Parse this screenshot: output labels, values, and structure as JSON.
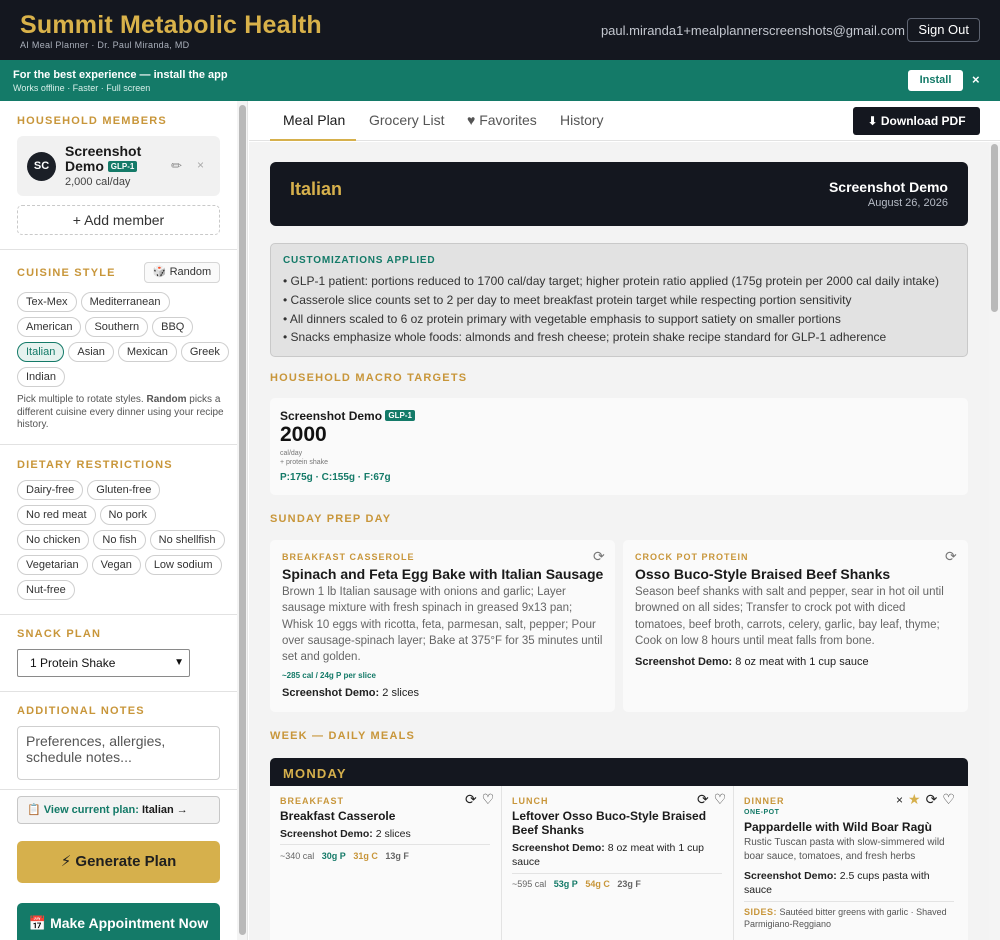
{
  "header": {
    "brand_title": "Summit Metabolic Health",
    "brand_sub": "AI Meal Planner · Dr. Paul Miranda, MD",
    "user_email": "paul.miranda1+mealplannerscreenshots@gmail.com",
    "sign_out": "Sign Out"
  },
  "install_banner": {
    "title": "For the best experience — install the app",
    "subtitle": "Works offline · Faster · Full screen",
    "install_label": "Install",
    "close_glyph": "×"
  },
  "sidebar": {
    "household_heading": "HOUSEHOLD MEMBERS",
    "member": {
      "initials": "SC",
      "name": "Screenshot Demo",
      "badge": "GLP-1",
      "calories": "2,000 cal/day",
      "edit_glyph": "✏",
      "remove_glyph": "×"
    },
    "add_member": "+ Add member",
    "cuisine_heading": "CUISINE STYLE",
    "random_label": "🎲 Random",
    "cuisines": [
      "Tex-Mex",
      "Mediterranean",
      "American",
      "Southern",
      "BBQ",
      "Italian",
      "Asian",
      "Mexican",
      "Greek",
      "Indian"
    ],
    "cuisine_selected": "Italian",
    "cuisine_note_a": "Pick multiple to rotate styles. ",
    "cuisine_note_b": "Random",
    "cuisine_note_c": " picks a different cuisine every dinner using your recipe history.",
    "dietary_heading": "DIETARY RESTRICTIONS",
    "dietary": [
      "Dairy-free",
      "Gluten-free",
      "No red meat",
      "No pork",
      "No chicken",
      "No fish",
      "No shellfish",
      "Vegetarian",
      "Vegan",
      "Low sodium",
      "Nut-free"
    ],
    "snack_heading": "SNACK PLAN",
    "snack_value": "1 Protein Shake",
    "notes_heading": "ADDITIONAL NOTES",
    "notes_placeholder": "Preferences, allergies, schedule notes...",
    "view_plan_prefix": "📋 View current plan: ",
    "view_plan_value": "Italian →",
    "generate_label": "⚡ Generate Plan",
    "appointment_label": "📅 Make Appointment Now"
  },
  "tabs": {
    "items": [
      "Meal Plan",
      "Grocery List",
      "♥ Favorites",
      "History"
    ],
    "active": "Meal Plan",
    "download_label": "⬇ Download PDF"
  },
  "plan": {
    "cuisine": "Italian",
    "owner": "Screenshot Demo",
    "date": "August 26, 2026"
  },
  "customizations": {
    "heading": "CUSTOMIZATIONS APPLIED",
    "items": [
      "• GLP-1 patient: portions reduced to 1700 cal/day target; higher protein ratio applied (175g protein per 2000 cal daily intake)",
      "• Casserole slice counts set to 2 per day to meet breakfast protein target while respecting portion sensitivity",
      "• All dinners scaled to 6 oz protein primary with vegetable emphasis to support satiety on smaller portions",
      "• Snacks emphasize whole foods: almonds and fresh cheese; protein shake recipe standard for GLP-1 adherence"
    ]
  },
  "macros": {
    "heading": "HOUSEHOLD MACRO TARGETS",
    "name": "Screenshot Demo",
    "badge": "GLP-1",
    "kcal": "2000",
    "cal_unit": "cal/day",
    "shake_note": "+ protein shake",
    "split": "P:175g · C:155g · F:67g"
  },
  "prep": {
    "heading": "SUNDAY PREP DAY",
    "cards": [
      {
        "tag": "BREAKFAST CASSEROLE",
        "title": "Spinach and Feta Egg Bake with Italian Sausage",
        "desc": "Brown 1 lb Italian sausage with onions and garlic; Layer sausage mixture with fresh spinach in greased 9x13 pan; Whisk 10 eggs with ricotta, feta, parmesan, salt, pepper; Pour over sausage-spinach layer; Bake at 375°F for 35 minutes until set and golden.",
        "nutrition": "~285 cal / 24g P per slice",
        "serving_name": "Screenshot Demo:",
        "serving": "2 slices"
      },
      {
        "tag": "CROCK POT PROTEIN",
        "title": "Osso Buco-Style Braised Beef Shanks",
        "desc": "Season beef shanks with salt and pepper, sear in hot oil until browned on all sides; Transfer to crock pot with diced tomatoes, beef broth, carrots, celery, garlic, bay leaf, thyme; Cook on low 8 hours until meat falls from bone.",
        "serving_name": "Screenshot Demo:",
        "serving": "8 oz meat with 1 cup sauce"
      }
    ]
  },
  "week": {
    "heading": "WEEK — DAILY MEALS",
    "day": "MONDAY",
    "meals": [
      {
        "type": "BREAKFAST",
        "name": "Breakfast Casserole",
        "serving_name": "Screenshot Demo:",
        "serving": "2 slices",
        "cal": "~340 cal",
        "p": "30g P",
        "c": "31g C",
        "f": "13g F"
      },
      {
        "type": "LUNCH",
        "name": "Leftover Osso Buco-Style Braised Beef Shanks",
        "serving_name": "Screenshot Demo:",
        "serving": "8 oz meat with 1 cup sauce",
        "cal": "~595 cal",
        "p": "53g P",
        "c": "54g C",
        "f": "23g F"
      },
      {
        "type": "DINNER",
        "subtype": "ONE-POT",
        "name": "Pappardelle with Wild Boar Ragù",
        "desc": "Rustic Tuscan pasta with slow-simmered wild boar sauce, tomatoes, and fresh herbs",
        "serving_name": "Screenshot Demo:",
        "serving": "2.5 cups pasta with sauce",
        "sides_label": "SIDES:",
        "sides": "Sautéed bitter greens with garlic · Shaved Parmigiano-Reggiano"
      }
    ]
  },
  "colors": {
    "gold": "#d6b04c",
    "teal": "#147a68",
    "dark": "#14171f"
  },
  "icons": {
    "refresh": "⟳",
    "heart": "♡",
    "star": "★",
    "close": "×"
  }
}
